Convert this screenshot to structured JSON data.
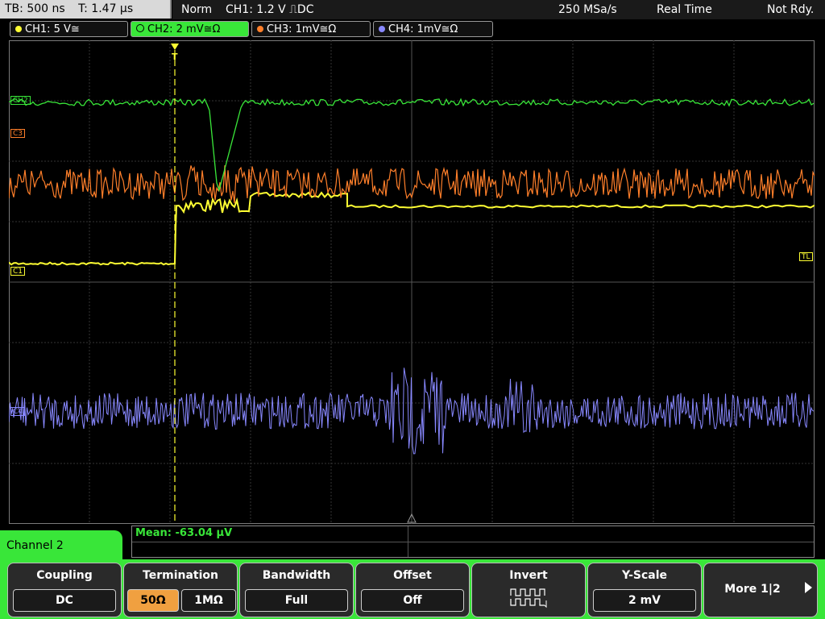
{
  "status": {
    "timebase": "TB: 500 ns",
    "trigger_time": "T: 1.47 µs",
    "mode": "Norm",
    "trigger": "CH1: 1.2 V ⎍DC",
    "sample_rate": "250 MSa/s",
    "acq_mode": "Real Time",
    "state": "Not Rdy."
  },
  "channels": [
    {
      "label": "CH1: 5 V≅",
      "color": "#ffff33"
    },
    {
      "label": "CH2: 2 mV≅Ω",
      "color": "#39e639"
    },
    {
      "label": "CH3: 1mV≅Ω",
      "color": "#ff7f2a"
    },
    {
      "label": "CH4: 1mV≅Ω",
      "color": "#8888ff"
    }
  ],
  "markers": {
    "ch2": "CH2",
    "ch3": "C3",
    "ch1": "C1",
    "ch4": "C4",
    "trigger_level": "TL",
    "trigger_pos": "T"
  },
  "measurement": {
    "text": "Mean: -63.04 µV"
  },
  "menu": {
    "title": "Channel 2",
    "coupling": {
      "label": "Coupling",
      "value": "DC"
    },
    "termination": {
      "label": "Termination",
      "opt1": "50Ω",
      "opt2": "1MΩ"
    },
    "bandwidth": {
      "label": "Bandwidth",
      "value": "Full"
    },
    "offset": {
      "label": "Offset",
      "value": "Off"
    },
    "invert": {
      "label": "Invert"
    },
    "yscale": {
      "label": "Y-Scale",
      "value": "2 mV"
    },
    "more": {
      "label": "More 1|2"
    }
  }
}
